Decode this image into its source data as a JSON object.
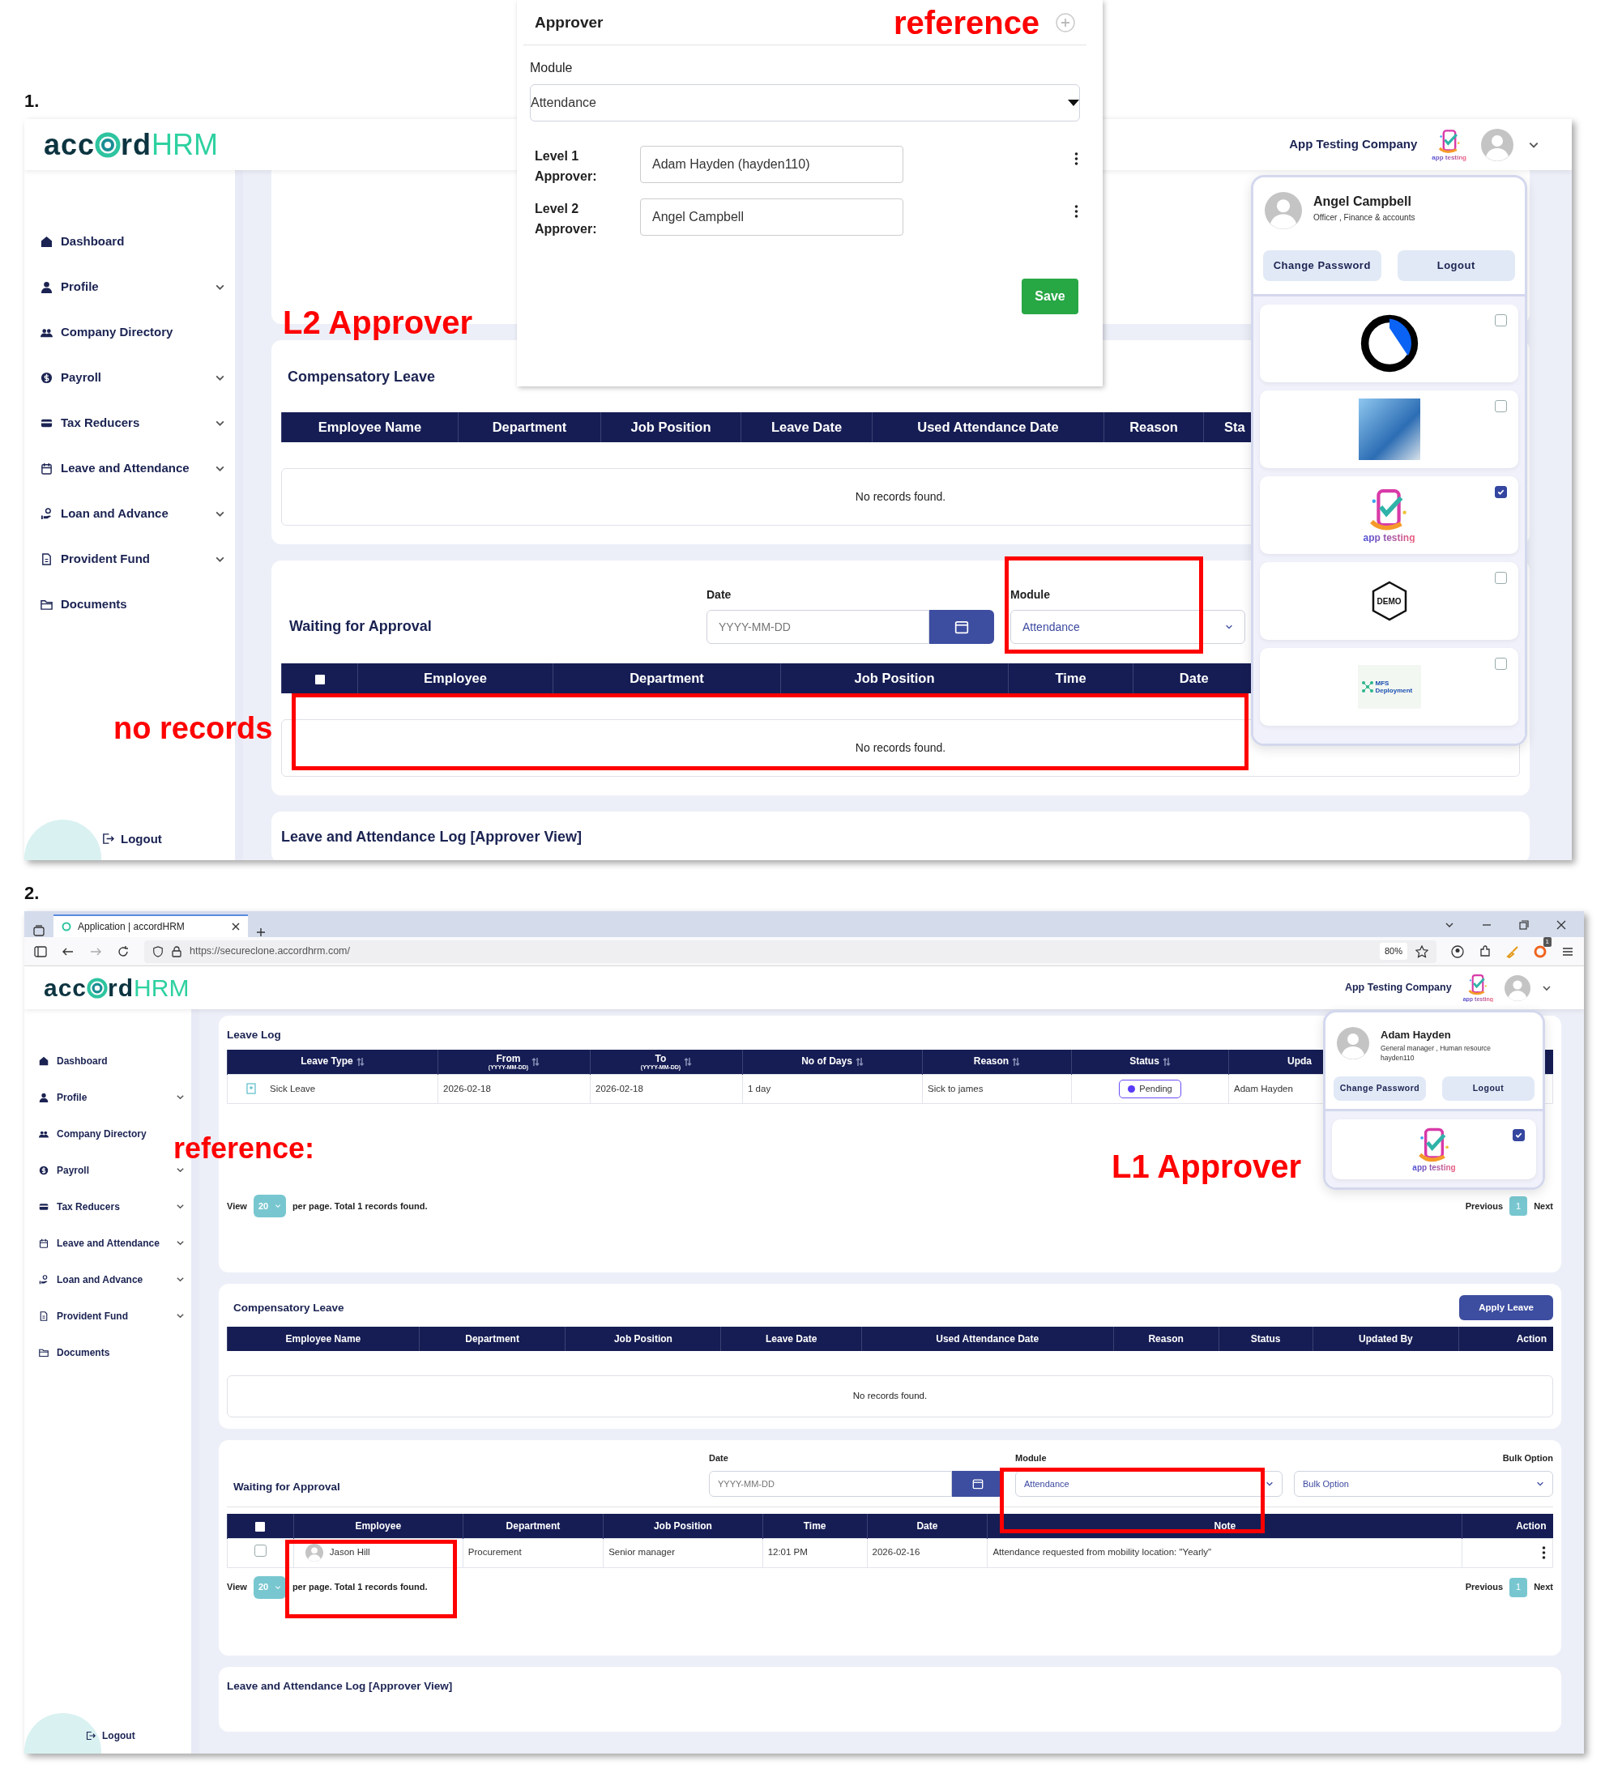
{
  "annotations": {
    "panel_labels": [
      "1.",
      "2."
    ],
    "notes": [
      "reference",
      "L2 Approver",
      "no records",
      "reference:",
      "L1 Approver"
    ]
  },
  "approver_snippet": {
    "title": "Approver",
    "module_label": "Module",
    "module_value": "Attendance",
    "levels": [
      {
        "label": "Level 1 Approver:",
        "value": "Adam Hayden (hayden110)"
      },
      {
        "label": "Level 2 Approver:",
        "value": "Angel Campbell"
      }
    ],
    "save": "Save"
  },
  "panel_1": {
    "logo": {
      "part_1": "acc",
      "part_2": "rd",
      "suffix": "HRM"
    },
    "company": "App Testing Company",
    "company_logo_caption": "app testing",
    "sidebar": {
      "items": [
        {
          "label": "Dashboard",
          "expandable": false
        },
        {
          "label": "Profile",
          "expandable": true
        },
        {
          "label": "Company Directory",
          "expandable": false
        },
        {
          "label": "Payroll",
          "expandable": true
        },
        {
          "label": "Tax Reducers",
          "expandable": true
        },
        {
          "label": "Leave and Attendance",
          "expandable": true
        },
        {
          "label": "Loan and Advance",
          "expandable": true
        },
        {
          "label": "Provident Fund",
          "expandable": true
        },
        {
          "label": "Documents",
          "expandable": false
        }
      ],
      "logout": "Logout"
    },
    "user_menu": {
      "name": "Angel Campbell",
      "role": "Officer , Finance & accounts",
      "buttons": [
        "Change Password",
        "Logout"
      ],
      "companies": [
        {
          "kind": "ring",
          "checked": false
        },
        {
          "kind": "photo",
          "checked": false
        },
        {
          "kind": "app",
          "caption": "app testing",
          "checked": true
        },
        {
          "kind": "demo",
          "caption": "DEMO",
          "checked": false
        },
        {
          "kind": "mfs",
          "caption": "MFS Deployment",
          "checked": false
        }
      ]
    },
    "compensatory_leave": {
      "title": "Compensatory Leave",
      "columns": [
        "Employee Name",
        "Department",
        "Job Position",
        "Leave Date",
        "Used Attendance Date",
        "Reason",
        "Sta"
      ],
      "empty": "No records found."
    },
    "waiting": {
      "title": "Waiting for Approval",
      "date_label": "Date",
      "date_placeholder": "YYYY-MM-DD",
      "module_label": "Module",
      "module_value": "Attendance",
      "columns": [
        "Employee",
        "Department",
        "Job Position",
        "Time",
        "Date"
      ],
      "empty": "No records found."
    },
    "log_title": "Leave and Attendance Log [Approver View]"
  },
  "panel_2": {
    "browser": {
      "tab_title": "Application | accordHRM",
      "url": "https://secureclone.accordhrm.com/",
      "zoom": "80%",
      "badge": "1"
    },
    "logo": {
      "part_1": "acc",
      "part_2": "rd",
      "suffix": "HRM"
    },
    "company": "App Testing Company",
    "company_logo_caption": "app testing",
    "sidebar": {
      "items": [
        {
          "label": "Dashboard",
          "expandable": false
        },
        {
          "label": "Profile",
          "expandable": true
        },
        {
          "label": "Company Directory",
          "expandable": false
        },
        {
          "label": "Payroll",
          "expandable": true
        },
        {
          "label": "Tax Reducers",
          "expandable": true
        },
        {
          "label": "Leave and Attendance",
          "expandable": true
        },
        {
          "label": "Loan and Advance",
          "expandable": true
        },
        {
          "label": "Provident Fund",
          "expandable": true
        },
        {
          "label": "Documents",
          "expandable": false
        }
      ],
      "logout": "Logout"
    },
    "user_menu": {
      "name": "Adam Hayden",
      "role": "General manager , Human resource",
      "username": "hayden110",
      "buttons": [
        "Change Password",
        "Logout"
      ],
      "companies": [
        {
          "kind": "app",
          "caption": "app testing",
          "checked": true
        }
      ]
    },
    "leave_log": {
      "title": "Leave Log",
      "columns": [
        {
          "label": "Leave Type",
          "sortable": true
        },
        {
          "label": "From",
          "sub": "(YYYY-MM-DD)",
          "sortable": true
        },
        {
          "label": "To",
          "sub": "(YYYY-MM-DD)",
          "sortable": true
        },
        {
          "label": "No of Days",
          "sortable": true
        },
        {
          "label": "Reason",
          "sortable": true
        },
        {
          "label": "Status",
          "sortable": true
        },
        {
          "label": "Upda",
          "sortable": false
        }
      ],
      "rows": [
        {
          "leave_type": "Sick Leave",
          "from": "2026-02-18",
          "to": "2026-02-18",
          "days": "1 day",
          "reason": "Sick to james",
          "status": "Pending",
          "updated_by": "Adam Hayden"
        }
      ],
      "pager": {
        "view": "View",
        "per_page": "20",
        "summary": "per page. Total 1 records found.",
        "previous": "Previous",
        "page": "1",
        "next": "Next"
      }
    },
    "compensatory_leave": {
      "title": "Compensatory Leave",
      "apply": "Apply Leave",
      "columns": [
        "Employee Name",
        "Department",
        "Job Position",
        "Leave Date",
        "Used Attendance Date",
        "Reason",
        "Status",
        "Updated By",
        "Action"
      ],
      "empty": "No records found."
    },
    "waiting": {
      "title": "Waiting for Approval",
      "date_label": "Date",
      "date_placeholder": "YYYY-MM-DD",
      "module_label": "Module",
      "module_value": "Attendance",
      "bulk_label": "Bulk Option",
      "bulk_value": "Bulk Option",
      "columns": [
        "Employee",
        "Department",
        "Job Position",
        "Time",
        "Date",
        "Note",
        "Action"
      ],
      "rows": [
        {
          "checked": false,
          "employee": "Jason Hill",
          "department": "Procurement",
          "job_position": "Senior manager",
          "time": "12:01 PM",
          "date": "2026-02-16",
          "note": "Attendance requested from mobility location: \"Yearly\""
        }
      ],
      "pager": {
        "view": "View",
        "per_page": "20",
        "summary": "per page. Total 1 records found.",
        "previous": "Previous",
        "page": "1",
        "next": "Next"
      }
    },
    "log_title": "Leave and Attendance Log [Approver View]"
  }
}
